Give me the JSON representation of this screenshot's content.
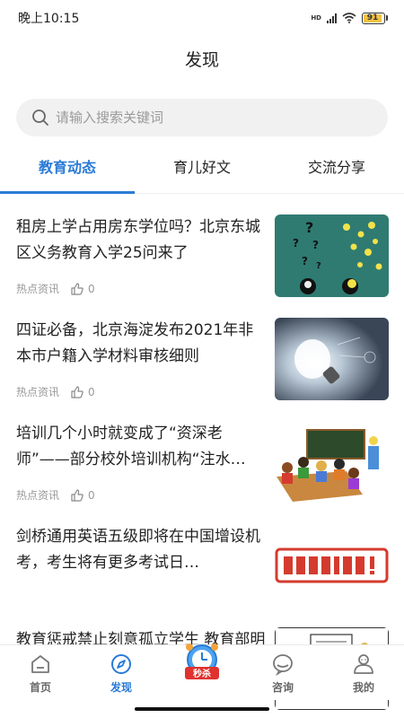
{
  "status": {
    "time": "晚上10:15",
    "battery": "91",
    "network": "HD"
  },
  "header": {
    "title": "发现"
  },
  "search": {
    "placeholder": "请输入搜索关键词"
  },
  "tabs": [
    {
      "label": "教育动态",
      "active": true
    },
    {
      "label": "育儿好文",
      "active": false
    },
    {
      "label": "交流分享",
      "active": false
    }
  ],
  "articles": [
    {
      "title": "租房上学占用房东学位吗？北京东城区义务教育入学25问来了",
      "category": "热点资讯",
      "likes": "0",
      "thumb": "question-marks-bulbs"
    },
    {
      "title": "四证必备，北京海淀发布2021年非本市户籍入学材料审核细则",
      "category": "热点资讯",
      "likes": "0",
      "thumb": "lightbulb-strategy"
    },
    {
      "title": "培训几个小时就变成了“资深老师”——部分校外培训机构“注水…",
      "category": "热点资讯",
      "likes": "0",
      "thumb": "classroom-cartoon"
    },
    {
      "title": "剑桥通用英语五级即将在中国增设机考，考生将有更多考试日…",
      "category": "",
      "likes": "",
      "thumb": "caution-sign"
    },
    {
      "title": " 教育惩戒禁止刻意孤立学生 教育部明确界定刻意孤立",
      "category": "",
      "likes": "",
      "thumb": "cartoon-sign"
    }
  ],
  "tabbar": [
    {
      "label": "首页",
      "icon": "home-icon",
      "active": false
    },
    {
      "label": "发现",
      "icon": "compass-icon",
      "active": true
    },
    {
      "label": "秒杀",
      "icon": "flash-sale-icon",
      "active": false
    },
    {
      "label": "咨询",
      "icon": "chat-icon",
      "active": false
    },
    {
      "label": "我的",
      "icon": "profile-icon",
      "active": false
    }
  ],
  "colors": {
    "accent": "#2a7bd6",
    "caution_red": "#d43b2e"
  }
}
